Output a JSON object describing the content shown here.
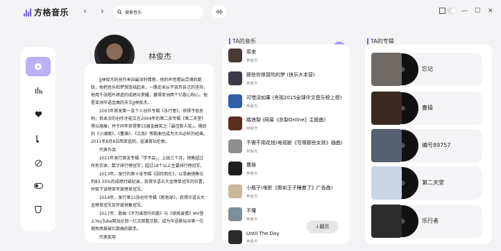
{
  "app": {
    "name": "方格音乐"
  },
  "header": {
    "back_icon": "‹",
    "forward_icon": "›",
    "search_placeholder": "搜索音乐",
    "minimize_icon": "—",
    "maximize_icon": "☐",
    "close_icon": "✕"
  },
  "sidebar": {
    "items": [
      {
        "icon": "disc-icon",
        "active": true
      },
      {
        "icon": "chart-icon"
      },
      {
        "icon": "heart-icon"
      },
      {
        "icon": "music-note-icon"
      },
      {
        "icon": "podcast-icon"
      },
      {
        "icon": "toggle-icon"
      },
      {
        "icon": "shield-icon"
      }
    ]
  },
  "artist": {
    "name": "林俊杰",
    "bio": [
      "JJ林俊杰的创作来自最深的情感，他的声音唱出灵魂的跳跃，他把音乐和梦想连结起来，一路走来从不放弃自己的坚持。他用千张唱片缔造的成绩与荣耀，赢得亚洲两个亿歌心和心。他是亚洲华语金曲的天王JJ林俊杰。",
      "2003年首发第一张个人创作专辑《乐行者》，获得不俗反响；其本次的创作才能又在2004年的第二张专辑《第二天堂》得以施展，并于同年获得第15届金曲奖之「最佳新人奖」。随后的《小酒窝》、《曹操》、《江南》等歌曲也成为大众必听的经典。2011年8月8日西亚巡回，巡演首站伦敦。",
      "代表作品",
      "2011年发行首张专辑「学不会」，上线三个月，销售超过所有实体、数字排行榜冠军；超过18个以上主要排行榜冠军。",
      "2013年，发行的第十张专辑《因你而在》，以单曲销售位列83.35%的成绩打破纪录，获得华语五大金榜单冠军的位置，并取下该榜单年度榜单冠军。",
      "2014年，发行第11张创作专辑《新地球》，获得华语五大金榜单冠军及年度销售冠军。",
      "2017年，歌曲《不为谁而作的歌》与《修炼爱情》MV登上YouTube网站达到一亿次观看次数，成为华语歌坛中第一位拥有两首破亿歌曲的歌手。",
      "代表奖项"
    ]
  },
  "songs_panel": {
    "title": "TA的音乐",
    "next_page_label": "↓翻页",
    "items": [
      {
        "title": "原来",
        "artist": "林俊杰",
        "cover": "#4a3a35"
      },
      {
        "title": "那些你很冒险的梦 (快乐大本营)",
        "artist": "林俊杰",
        "cover": "#3a3a48"
      },
      {
        "title": "可惜没如果 (央视2015全球中文音乐榜上榜)",
        "artist": "林俊杰",
        "cover": "#2f5fa8"
      },
      {
        "title": "踏浪梨 (网易《亦梨Online》主题曲)",
        "artist": "林俊杰",
        "cover": "#5a2f1f"
      },
      {
        "title": "不需不用花钱(电视剧《写得那些女孩》插曲)",
        "artist": "林俊杰",
        "cover": "#8e8e8e"
      },
      {
        "title": "曹操",
        "artist": "林俊杰",
        "cover": "#1f1f1f"
      },
      {
        "title": "小瓶子(电影《假如王子睡着了》广告曲)",
        "artist": "林俊杰",
        "cover": "#c9b79a"
      },
      {
        "title": "不懂",
        "artist": "林俊杰",
        "cover": "#7d8f9a"
      },
      {
        "title": "Until The Day",
        "artist": "林俊杰",
        "cover": "#2a2a2a"
      }
    ]
  },
  "albums_panel": {
    "title": "TA的专辑",
    "items": [
      {
        "title": "忘记",
        "cover": "#6f6a66"
      },
      {
        "title": "曹操",
        "cover": "#3a2a22"
      },
      {
        "title": "编号89757",
        "cover": "#556070"
      },
      {
        "title": "第二天堂",
        "cover": "#c9d6e4"
      },
      {
        "title": "乐行者",
        "cover": "#2c2c2c"
      }
    ]
  },
  "colors": {
    "accent": "#6f5cf0",
    "accent_light": "#b9b0f5"
  }
}
